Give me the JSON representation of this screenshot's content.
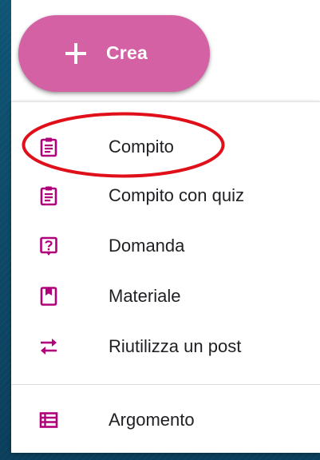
{
  "colors": {
    "accent": "#d561a5",
    "icon": "#b0007a",
    "text": "#202124",
    "highlight": "#e0101a"
  },
  "create_button": {
    "label": "Crea",
    "icon": "plus-icon"
  },
  "menu": {
    "items": [
      {
        "label": "Compito",
        "icon": "assignment-icon",
        "highlighted": true
      },
      {
        "label": "Compito con quiz",
        "icon": "quiz-assignment-icon"
      },
      {
        "label": "Domanda",
        "icon": "question-icon"
      },
      {
        "label": "Materiale",
        "icon": "material-icon"
      },
      {
        "label": "Riutilizza un post",
        "icon": "reuse-icon"
      },
      {
        "label": "Argomento",
        "icon": "topic-icon"
      }
    ]
  }
}
